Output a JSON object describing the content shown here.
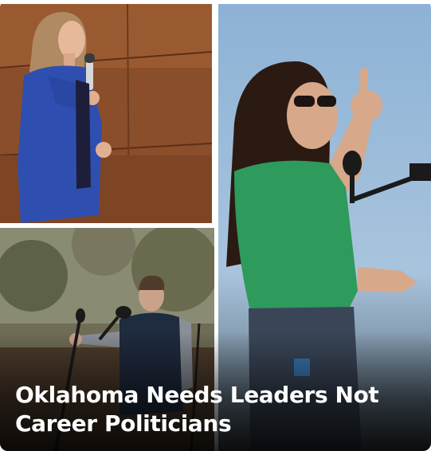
{
  "post": {
    "headline": "Oklahoma Needs Leaders Not Career Politicians"
  },
  "photos": [
    {
      "subject": "woman-in-blue-suit-speaking"
    },
    {
      "subject": "woman-in-green-shirt-at-microphone"
    },
    {
      "subject": "man-in-vest-at-outdoor-microphone"
    }
  ],
  "colors": {
    "headline_text": "#ffffff",
    "suit_blue": "#2f4fb0",
    "shirt_green": "#2e9a5c",
    "sky_blue": "#7ea7cf"
  }
}
